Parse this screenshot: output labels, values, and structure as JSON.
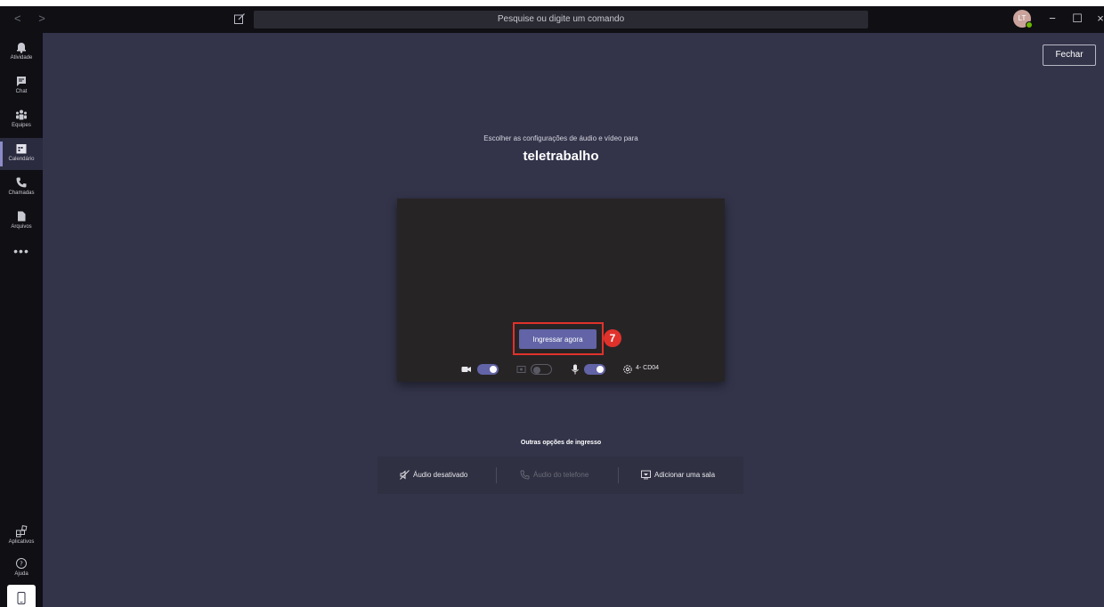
{
  "titlebar": {
    "back_forward": "< >",
    "search_placeholder": "Pesquise ou digite um comando",
    "avatar_initials": "LT",
    "minimize": "−",
    "maximize": "☐",
    "close": "×"
  },
  "rail": {
    "items": [
      {
        "label": "Atividade",
        "icon": "bell-icon"
      },
      {
        "label": "Chat",
        "icon": "chat-icon"
      },
      {
        "label": "Equipes",
        "icon": "teams-icon"
      },
      {
        "label": "Calendário",
        "icon": "calendar-icon",
        "active": true
      },
      {
        "label": "Chamadas",
        "icon": "phone-icon"
      },
      {
        "label": "Arquivos",
        "icon": "file-icon"
      }
    ],
    "more": "•••",
    "bottom_items": [
      {
        "label": "Aplicativos",
        "icon": "apps-icon"
      },
      {
        "label": "Ajuda",
        "icon": "help-icon"
      }
    ]
  },
  "main": {
    "close_label": "Fechar",
    "subtitle": "Escolher as configurações de áudio e vídeo para",
    "meeting_title": "teletrabalho",
    "join_label": "Ingressar agora",
    "step_number": "7",
    "camera_on": true,
    "blur_on": false,
    "mic_on": true,
    "device_label": "4- CD04",
    "other_options_label": "Outras opções de ingresso",
    "options": [
      {
        "label": "Áudio desativado",
        "icon": "speaker-off-icon",
        "enabled": true
      },
      {
        "label": "Áudio do telefone",
        "icon": "phone-icon",
        "enabled": false
      },
      {
        "label": "Adicionar uma sala",
        "icon": "room-display-icon",
        "enabled": true
      }
    ]
  },
  "colors": {
    "accent": "#6264a7",
    "background": "#33344a",
    "rail": "#0f0f14",
    "highlight": "#e0322b"
  }
}
